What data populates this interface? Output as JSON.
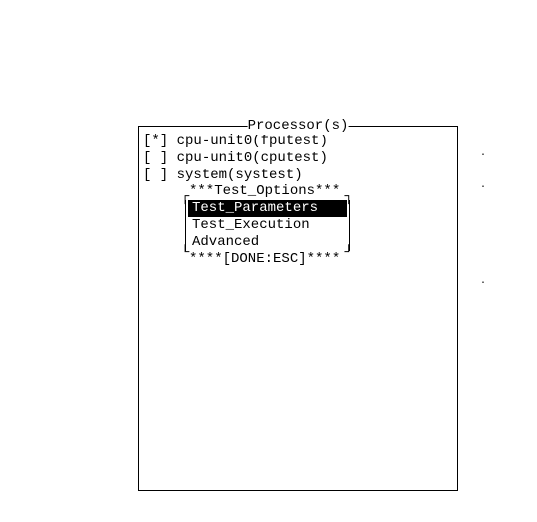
{
  "panel": {
    "title": "Processor(s)"
  },
  "items": [
    {
      "checked": "[*]",
      "label": " cpu-unit0(fputest)"
    },
    {
      "checked": "[ ]",
      "label": " cpu-unit0(cputest)"
    },
    {
      "checked": "[ ]",
      "label": " system(systest)"
    }
  ],
  "popup": {
    "title": "***Test_Options***",
    "options": [
      {
        "label": "Test_Parameters",
        "selected": true
      },
      {
        "label": "Test_Execution",
        "selected": false
      },
      {
        "label": "Advanced",
        "selected": false
      }
    ],
    "footer": "****[DONE:ESC]****"
  }
}
